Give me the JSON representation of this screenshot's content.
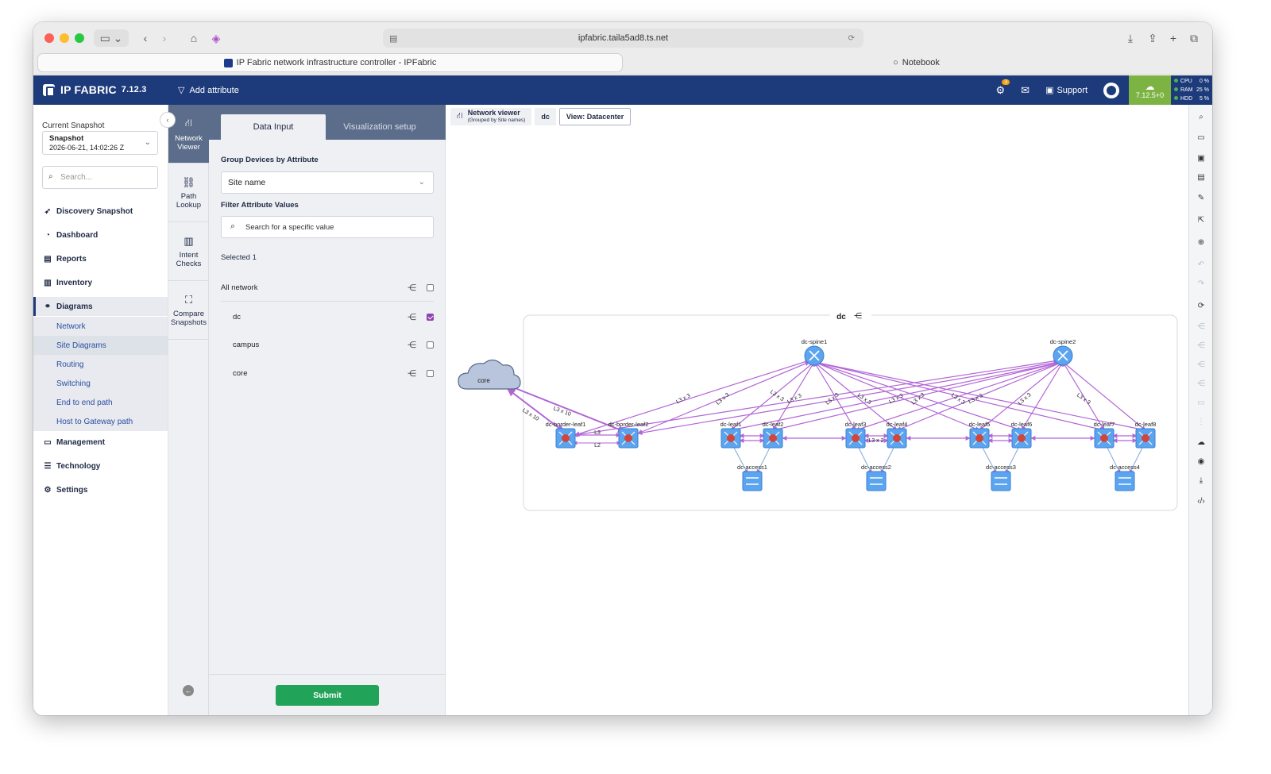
{
  "browser": {
    "url": "ipfabric.taila5ad8.ts.net",
    "tabs": [
      {
        "label": "IP Fabric network infrastructure controller - IPFabric"
      },
      {
        "label": "Notebook"
      }
    ]
  },
  "header": {
    "brand": "IP FABRIC",
    "version": "7.12.3",
    "add_attribute": "Add attribute",
    "tasks_badge": "3",
    "support": "Support",
    "cloud_version": "7.12.5+0",
    "resources": [
      {
        "label": "CPU",
        "value": "0 %"
      },
      {
        "label": "RAM",
        "value": "25 %"
      },
      {
        "label": "HDD",
        "value": "5 %"
      }
    ]
  },
  "nav": {
    "snapshot_label": "Current Snapshot",
    "snapshot_title": "Snapshot",
    "snapshot_date": "2026-06-21, 14:02:26 Z",
    "search_placeholder": "Search...",
    "items": [
      {
        "label": "Discovery Snapshot",
        "icon": "rocket-icon"
      },
      {
        "label": "Dashboard",
        "icon": "dashboard-icon"
      },
      {
        "label": "Reports",
        "icon": "report-icon"
      },
      {
        "label": "Inventory",
        "icon": "inventory-icon"
      },
      {
        "label": "Diagrams",
        "icon": "diagram-icon"
      },
      {
        "label": "Management",
        "icon": "monitor-icon"
      },
      {
        "label": "Technology",
        "icon": "technology-icon"
      },
      {
        "label": "Settings",
        "icon": "gear-icon"
      }
    ],
    "diagram_subitems": [
      "Network",
      "Site Diagrams",
      "Routing",
      "Switching",
      "End to end path",
      "Host to Gateway path"
    ]
  },
  "tools": [
    {
      "label": "Network Viewer"
    },
    {
      "label": "Path Lookup"
    },
    {
      "label": "Intent Checks"
    },
    {
      "label": "Compare Snapshots"
    }
  ],
  "panel": {
    "tab_data_input": "Data Input",
    "tab_visualization": "Visualization setup",
    "group_label": "Group Devices by Attribute",
    "group_value": "Site name",
    "filter_label": "Filter Attribute Values",
    "filter_placeholder": "Search for a specific value",
    "selected_text": "Selected 1",
    "rows": [
      {
        "label": "All network",
        "checked": false
      },
      {
        "label": "dc",
        "checked": true
      },
      {
        "label": "campus",
        "checked": false
      },
      {
        "label": "core",
        "checked": false
      }
    ],
    "submit": "Submit"
  },
  "canvas": {
    "crumb_title": "Network viewer",
    "crumb_sub": "(Grouped by Site names)",
    "crumb_site": "dc",
    "crumb_view": "View: Datacenter"
  },
  "diagram": {
    "group_label": "dc",
    "cloud_label": "core",
    "spines": [
      "dc-spine1",
      "dc-spine2"
    ],
    "leaves": [
      "dc-border-leaf1",
      "dc-border-leaf2",
      "dc-leaf1",
      "dc-leaf2",
      "dc-leaf3",
      "dc-leaf4",
      "dc-leaf5",
      "dc-leaf6",
      "dc-leaf7",
      "dc-leaf8"
    ],
    "access": [
      "dc-access1",
      "dc-access2",
      "dc-access3",
      "dc-access4"
    ],
    "link_labels": {
      "core_border": "L3 x 10",
      "spine_leaf": "L3 x 3",
      "border_l3": "L3",
      "border_l2": "L2",
      "leaf_pair": "L3 x 2"
    },
    "colors": {
      "link": "#b266d6",
      "device": "#5ba4f0",
      "device_dot": "#d0463c",
      "cloud": "#b8c5dc"
    }
  }
}
